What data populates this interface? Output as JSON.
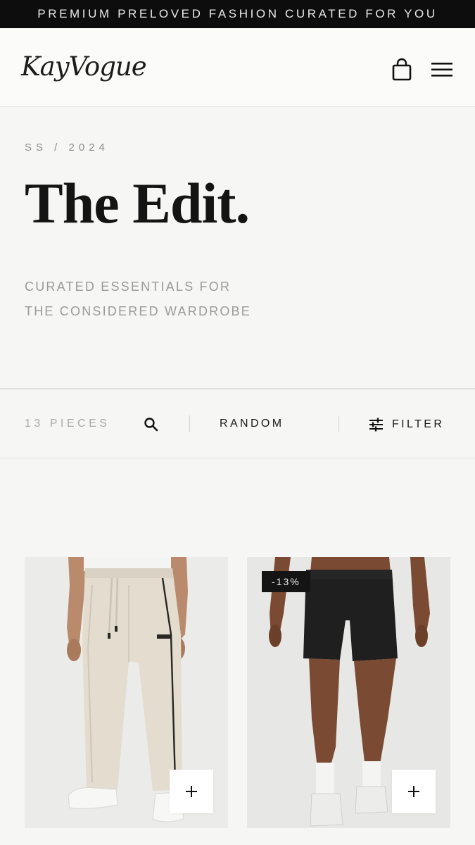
{
  "announcement": "PREMIUM PRELOVED FASHION CURATED FOR YOU",
  "header": {
    "logo": "KayVogue",
    "cart_icon": "shopping-bag-icon",
    "menu_icon": "hamburger-menu-icon"
  },
  "hero": {
    "season": "SS / 2024",
    "title": "The Edit.",
    "subtitle_lines": [
      "CURATED ESSENTIALS FOR",
      "THE CONSIDERED WARDROBE"
    ]
  },
  "toolbar": {
    "count": "13 PIECES",
    "search_icon": "search-icon",
    "sort": "RANDOM",
    "filter_icon": "sliders-icon",
    "filter_label": "FILTER"
  },
  "products": [
    {
      "image": "cream-track-pants",
      "badge": "",
      "add_label": "+"
    },
    {
      "image": "black-athletic-shorts",
      "badge": "-13%",
      "add_label": "+"
    }
  ],
  "colors": {
    "announcement_bg": "#0d0d0d",
    "page_bg": "#f6f6f4",
    "text": "#1a1a1a",
    "muted_text": "#9a9a96"
  }
}
